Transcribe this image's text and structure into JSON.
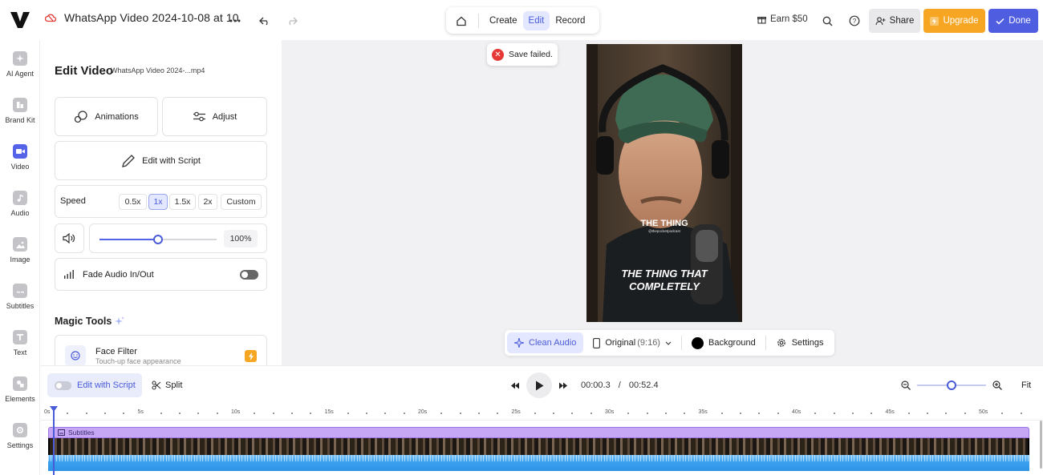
{
  "topbar": {
    "project_title": "WhatsApp Video 2024-10-08 at 10",
    "nav_tabs": [
      "Create",
      "Edit",
      "Record"
    ],
    "earn": "Earn $50",
    "share": "Share",
    "upgrade": "Upgrade",
    "done": "Done"
  },
  "sidebar": {
    "items": [
      "AI Agent",
      "Brand Kit",
      "Video",
      "Audio",
      "Image",
      "Subtitles",
      "Text",
      "Elements",
      "Settings"
    ]
  },
  "panel": {
    "title": "Edit Video",
    "filename": "WhatsApp Video 2024-...mp4",
    "animations": "Animations",
    "adjust": "Adjust",
    "edit_with_script": "Edit with Script",
    "speed_label": "Speed",
    "speed_options": [
      "0.5x",
      "1x",
      "1.5x",
      "2x",
      "Custom"
    ],
    "volume": "100%",
    "volume_level": 0.5,
    "fade": "Fade Audio In/Out",
    "magic_tools": "Magic Tools",
    "face_filter_title": "Face Filter",
    "face_filter_sub": "Touch-up face appearance"
  },
  "preview": {
    "toast": "Save failed.",
    "caption_top": "THE THING",
    "caption_handle": "@thepocketpodcast",
    "caption_main_1": "THE THING THAT",
    "caption_main_2": "COMPLETELY",
    "clean_audio": "Clean Audio",
    "original": "Original",
    "ratio": "(9:16)",
    "background": "Background",
    "settings": "Settings"
  },
  "timeline": {
    "edit_with_script": "Edit with Script",
    "split": "Split",
    "current_time": "00:00.3",
    "divider": "/",
    "total_time": "00:52.4",
    "fit": "Fit",
    "ruler_labels": [
      "0s",
      "5s",
      "10s",
      "15s",
      "20s",
      "25s",
      "30s",
      "35s",
      "40s",
      "45s",
      "50s"
    ],
    "subtitles_track": "Subtitles"
  }
}
